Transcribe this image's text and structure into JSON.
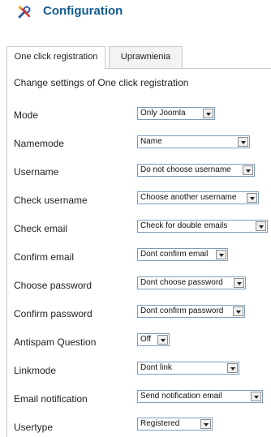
{
  "header": {
    "title": "Configuration",
    "icon": "tools-icon"
  },
  "tabs": [
    {
      "label": "One click registration",
      "active": true
    },
    {
      "label": "Uprawnienia",
      "active": false
    }
  ],
  "panel": {
    "heading": "Change settings of One click registration",
    "fields": [
      {
        "label": "Mode",
        "value": "Only Joomla"
      },
      {
        "label": "Namemode",
        "value": "Name"
      },
      {
        "label": "Username",
        "value": "Do not choose username"
      },
      {
        "label": "Check username",
        "value": "Choose another username"
      },
      {
        "label": "Check email",
        "value": "Check for double emails"
      },
      {
        "label": "Confirm email",
        "value": "Dont confirm email"
      },
      {
        "label": "Choose password",
        "value": "Dont choose password"
      },
      {
        "label": "Confirm password",
        "value": "Dont confirm password"
      },
      {
        "label": "Antispam Question",
        "value": "Off"
      },
      {
        "label": "Linkmode",
        "value": "Dont link"
      },
      {
        "label": "Email notification",
        "value": "Send notification email"
      },
      {
        "label": "Usertype",
        "value": "Registered"
      }
    ]
  }
}
